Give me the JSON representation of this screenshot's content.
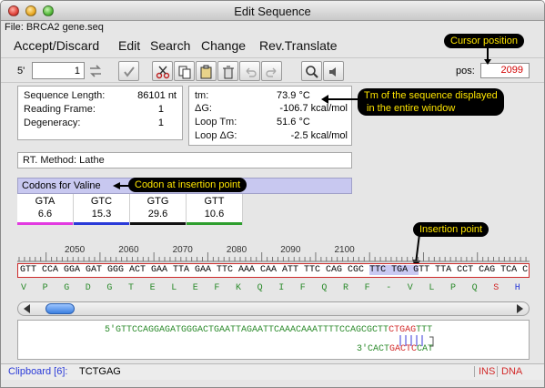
{
  "window": {
    "title": "Edit Sequence",
    "file_label": "File: BRCA2 gene.seq"
  },
  "menu": {
    "items": [
      "Accept/Discard",
      "Edit",
      "Search",
      "Change",
      "Rev.Translate"
    ]
  },
  "toolbar": {
    "frame_label": "5'",
    "frame_value": "1",
    "pos_label": "pos:",
    "pos_value": "2099"
  },
  "stats": {
    "seq_length_label": "Sequence Length:",
    "seq_length_value": "86101 nt",
    "reading_frame_label": "Reading Frame:",
    "reading_frame_value": "1",
    "degeneracy_label": "Degeneracy:",
    "degeneracy_value": "1"
  },
  "thermo": {
    "tm_label": "tm:",
    "tm_value": "73.9 °C",
    "dg_label": "ΔG:",
    "dg_value": "-106.7 kcal/mol",
    "loop_tm_label": "Loop Tm:",
    "loop_tm_value": "51.6 °C",
    "loop_dg_label": "Loop ΔG:",
    "loop_dg_value": "-2.5 kcal/mol"
  },
  "rt_method": "RT. Method: Lathe",
  "codons": {
    "header": "Codons for Valine",
    "items": [
      {
        "codon": "GTA",
        "value": "6.6",
        "color": "#e23ae0"
      },
      {
        "codon": "GTC",
        "value": "15.3",
        "color": "#2a3ad8"
      },
      {
        "codon": "GTG",
        "value": "29.6",
        "color": "#111111"
      },
      {
        "codon": "GTT",
        "value": "10.6",
        "color": "#2e9e2e"
      }
    ]
  },
  "ruler": {
    "ticks": [
      "2050",
      "2060",
      "2070",
      "2080",
      "2090",
      "2100"
    ]
  },
  "sequence": {
    "dna_before": "GTT CCA GGA GAT GGG ACT GAA TTA GAA TTC AAA CAA ATT TTC CAG CGC ",
    "dna_highlight": "TTC TGA G",
    "dna_after": "TT TTA CCT CAG TCA C",
    "aa": [
      "V",
      "P",
      "G",
      "D",
      "G",
      "T",
      "E",
      "L",
      "E",
      "F",
      "K",
      "Q",
      "I",
      "F",
      "Q",
      "R",
      "F",
      "-",
      "V",
      "L",
      "P",
      "Q",
      "S",
      "H"
    ],
    "aa_colors": [
      "#2a8a2a",
      "#2a8a2a",
      "#2a8a2a",
      "#2a8a2a",
      "#2a8a2a",
      "#2a8a2a",
      "#2a8a2a",
      "#2a8a2a",
      "#2a8a2a",
      "#2a8a2a",
      "#2a8a2a",
      "#2a8a2a",
      "#2a8a2a",
      "#2a8a2a",
      "#2a8a2a",
      "#2a8a2a",
      "#2a8a2a",
      "#2a8a2a",
      "#2a8a2a",
      "#2a8a2a",
      "#2a8a2a",
      "#2a8a2a",
      "#d22a2a",
      "#2a3ad8"
    ]
  },
  "primer": {
    "top_prefix": "5'GTTCCAGGAGATGGGACTGAATTAGAATTCAAACAAATTTTCCAGCGCTT",
    "top_red": "CTGAG",
    "top_suffix": "TTT",
    "bottom_prefix": "3'CACT",
    "bottom_red": "GACTC",
    "bottom_suffix": "CAT"
  },
  "status": {
    "clipboard_label": "Clipboard [6]:",
    "clipboard_value": "TCTGAG",
    "ins": "INS",
    "dna": "DNA"
  },
  "callouts": {
    "cursor": "Cursor position",
    "tm": "Tm of the sequence displayed\n in the entire window",
    "codon": "Codon at insertion point",
    "insertion": "Insertion point"
  }
}
